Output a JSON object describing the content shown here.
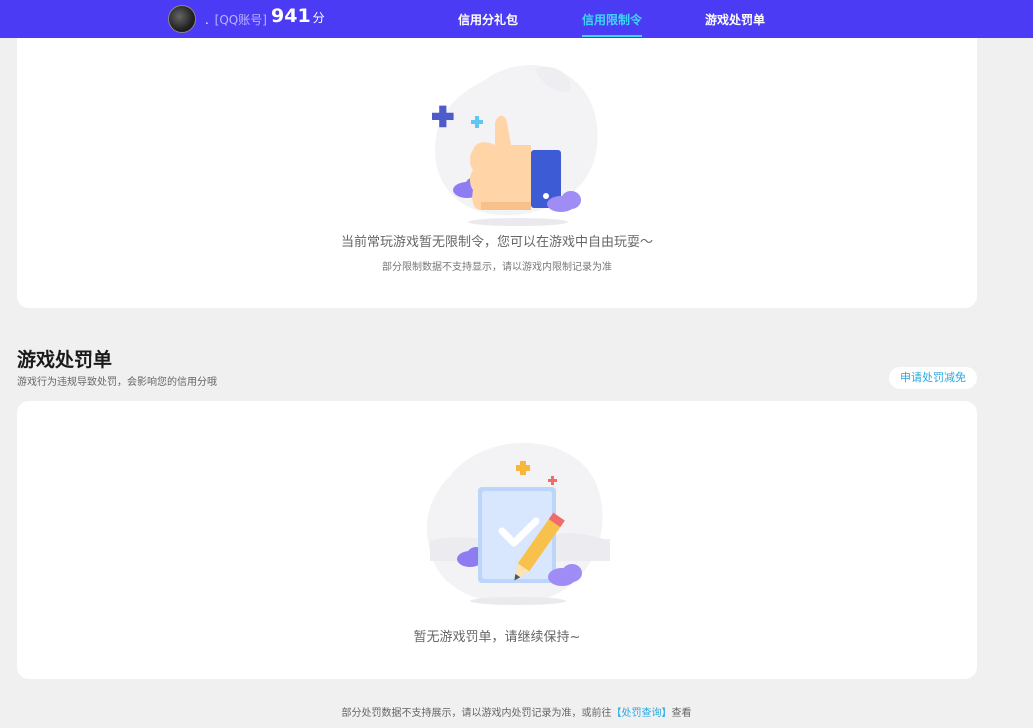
{
  "header": {
    "account_prefix": ".",
    "account_label": "[QQ账号]",
    "score": "941",
    "score_unit": "分",
    "tabs": [
      {
        "label": "信用分礼包",
        "active": false
      },
      {
        "label": "信用限制令",
        "active": true
      },
      {
        "label": "游戏处罚单",
        "active": false
      }
    ]
  },
  "restriction_card": {
    "message": "当前常玩游戏暂无限制令，您可以在游戏中自由玩耍～",
    "note": "部分限制数据不支持显示，请以游戏内限制记录为准"
  },
  "penalty_section": {
    "title": "游戏处罚单",
    "description": "游戏行为违规导致处罚，会影响您的信用分哦",
    "apply_button": "申请处罚减免",
    "empty_message": "暂无游戏罚单，请继续保持~"
  },
  "footer": {
    "text_before": "部分处罚数据不支持展示，请以游戏内处罚记录为准，或前往",
    "link": "【处罚查询】",
    "text_after": "查看"
  },
  "colors": {
    "header_bg": "#4c3bf5",
    "active_tab": "#3ed5f5",
    "link": "#2aa8e0",
    "page_bg": "#f0f0f0"
  },
  "icons": [
    "avatar",
    "thumbs-up-illustration",
    "checklist-pencil-illustration"
  ]
}
